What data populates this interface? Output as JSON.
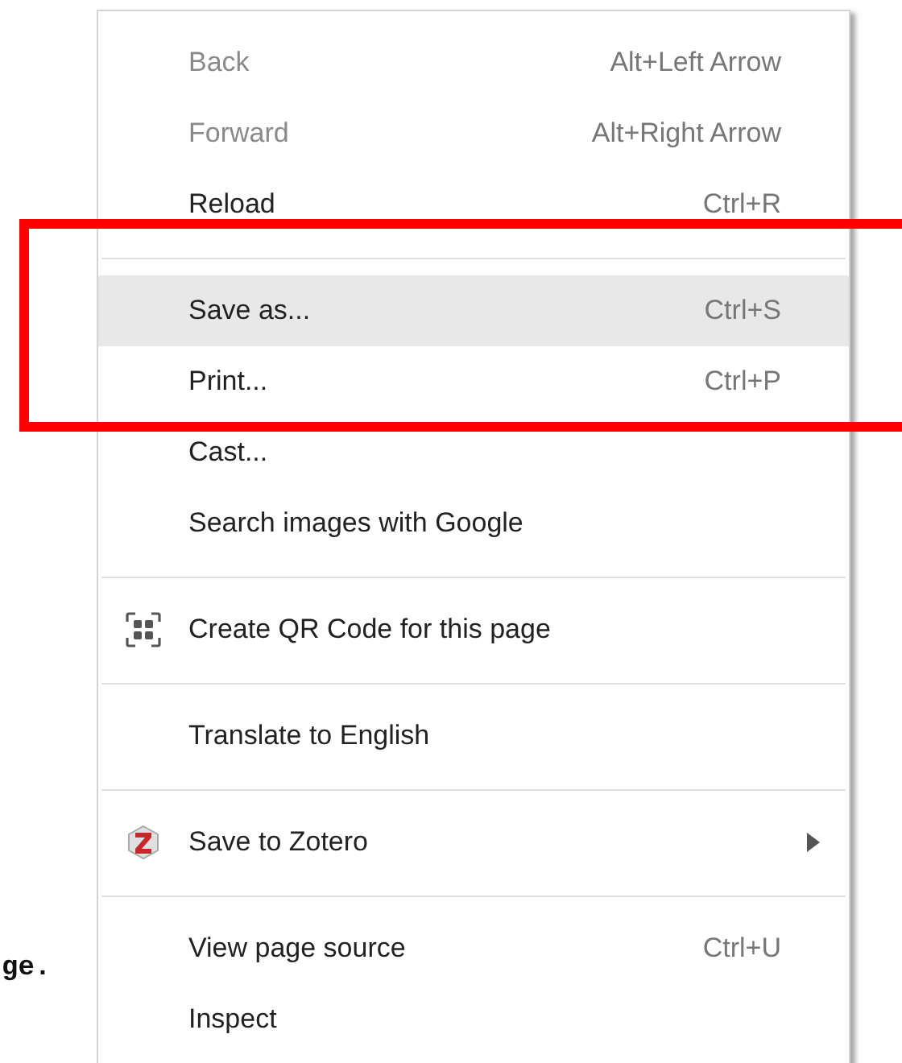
{
  "page_text": "ge.",
  "menu": {
    "sections": [
      {
        "items": [
          {
            "label": "Back",
            "shortcut": "Alt+Left Arrow",
            "disabled": true,
            "selected": false,
            "submenu": false
          },
          {
            "label": "Forward",
            "shortcut": "Alt+Right Arrow",
            "disabled": true,
            "selected": false,
            "submenu": false
          },
          {
            "label": "Reload",
            "shortcut": "Ctrl+R",
            "disabled": false,
            "selected": false,
            "submenu": false
          }
        ]
      },
      {
        "items": [
          {
            "label": "Save as...",
            "shortcut": "Ctrl+S",
            "disabled": false,
            "selected": true,
            "submenu": false
          },
          {
            "label": "Print...",
            "shortcut": "Ctrl+P",
            "disabled": false,
            "selected": false,
            "submenu": false
          },
          {
            "label": "Cast...",
            "disabled": false,
            "selected": false,
            "submenu": false
          },
          {
            "label": "Search images with Google",
            "disabled": false,
            "selected": false,
            "submenu": false
          }
        ]
      },
      {
        "items": [
          {
            "label": "Create QR Code for this page",
            "kind": "qr",
            "disabled": false,
            "selected": false,
            "submenu": false
          }
        ]
      },
      {
        "items": [
          {
            "label": "Translate to English",
            "disabled": false,
            "selected": false,
            "submenu": false
          }
        ]
      },
      {
        "items": [
          {
            "label": "Save to Zotero",
            "kind": "zotero",
            "disabled": false,
            "selected": false,
            "submenu": true
          }
        ]
      },
      {
        "items": [
          {
            "label": "View page source",
            "shortcut": "Ctrl+U",
            "disabled": false,
            "selected": false,
            "submenu": false
          },
          {
            "label": "Inspect",
            "disabled": false,
            "selected": false,
            "submenu": false
          }
        ]
      }
    ]
  },
  "annotations": [
    {
      "kind": "frame"
    }
  ]
}
